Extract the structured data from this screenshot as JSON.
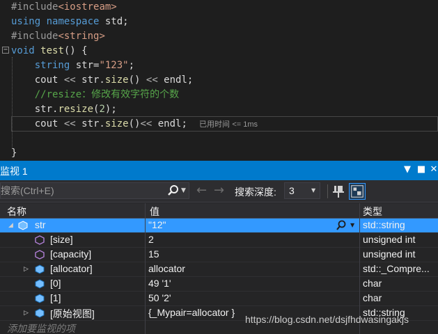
{
  "editor": {
    "lines": [
      [
        {
          "c": "pp",
          "t": "#include"
        },
        {
          "c": "inc",
          "t": "<iostream>"
        }
      ],
      [
        {
          "c": "kw",
          "t": "using"
        },
        {
          "c": "id",
          "t": " "
        },
        {
          "c": "kw",
          "t": "namespace"
        },
        {
          "c": "id",
          "t": " std;"
        }
      ],
      [
        {
          "c": "pp",
          "t": "#include"
        },
        {
          "c": "inc",
          "t": "<string>"
        }
      ],
      [
        {
          "c": "kw",
          "t": "void"
        },
        {
          "c": "id",
          "t": " "
        },
        {
          "c": "fn",
          "t": "test"
        },
        {
          "c": "id",
          "t": "() {"
        }
      ],
      [
        {
          "c": "id",
          "t": "    "
        },
        {
          "c": "kw",
          "t": "string"
        },
        {
          "c": "id",
          "t": " str="
        },
        {
          "c": "str",
          "t": "\"123\""
        },
        {
          "c": "id",
          "t": ";"
        }
      ],
      [
        {
          "c": "id",
          "t": "    cout "
        },
        {
          "c": "op",
          "t": "<<"
        },
        {
          "c": "id",
          "t": " str."
        },
        {
          "c": "fn",
          "t": "size"
        },
        {
          "c": "id",
          "t": "() "
        },
        {
          "c": "op",
          "t": "<<"
        },
        {
          "c": "id",
          "t": " endl;"
        }
      ],
      [
        {
          "c": "cm",
          "t": "    //resize：修改有效字符的个数"
        }
      ],
      [
        {
          "c": "id",
          "t": "    str."
        },
        {
          "c": "fn",
          "t": "resize"
        },
        {
          "c": "id",
          "t": "("
        },
        {
          "c": "num",
          "t": "2"
        },
        {
          "c": "id",
          "t": ");"
        }
      ],
      [
        {
          "c": "id",
          "t": "    cout "
        },
        {
          "c": "op",
          "t": "<<"
        },
        {
          "c": "id",
          "t": " str."
        },
        {
          "c": "fn",
          "t": "size"
        },
        {
          "c": "id",
          "t": "()"
        },
        {
          "c": "op",
          "t": "<<"
        },
        {
          "c": "id",
          "t": " endl;"
        }
      ],
      [],
      [
        {
          "c": "id",
          "t": "}"
        }
      ]
    ],
    "elapsed_label": "已用时间",
    "elapsed_value": "<= 1ms",
    "fold_glyph": "−"
  },
  "watch": {
    "title": "监视 1",
    "title_buttons": [
      "▼",
      "■",
      "✕"
    ],
    "search_placeholder": "搜索(Ctrl+E)",
    "back_glyph": "←",
    "forward_glyph": "→",
    "depth_label": "搜索深度:",
    "depth_value": "3",
    "columns": {
      "name": "名称",
      "value": "值",
      "type": "类型"
    },
    "rows": [
      {
        "expander": "◢",
        "icon": "object-icon",
        "name": "str",
        "value": "\"12\"",
        "type": "std::string"
      },
      {
        "expander": "",
        "icon": "property-icon",
        "name": "[size]",
        "value": "2",
        "type": "unsigned int"
      },
      {
        "expander": "",
        "icon": "property-icon",
        "name": "[capacity]",
        "value": "15",
        "type": "unsigned int"
      },
      {
        "expander": "▷",
        "icon": "object-icon",
        "name": "[allocator]",
        "value": "allocator",
        "type": "std::_Compre..."
      },
      {
        "expander": "",
        "icon": "object-icon",
        "name": "[0]",
        "value": "49 '1'",
        "type": "char"
      },
      {
        "expander": "",
        "icon": "object-icon",
        "name": "[1]",
        "value": "50 '2'",
        "type": "char"
      },
      {
        "expander": "▷",
        "icon": "object-icon",
        "name": "[原始视图]",
        "value": "{_Mypair=allocator }",
        "type": "std::string"
      }
    ],
    "add_hint": "添加要监视的项"
  },
  "watermark": "https://blog.csdn.net/dsjfhdwasingakjs",
  "colors": {
    "accent": "#007acc",
    "selection": "#3399ff",
    "editor_bg": "#1e1e1e"
  }
}
